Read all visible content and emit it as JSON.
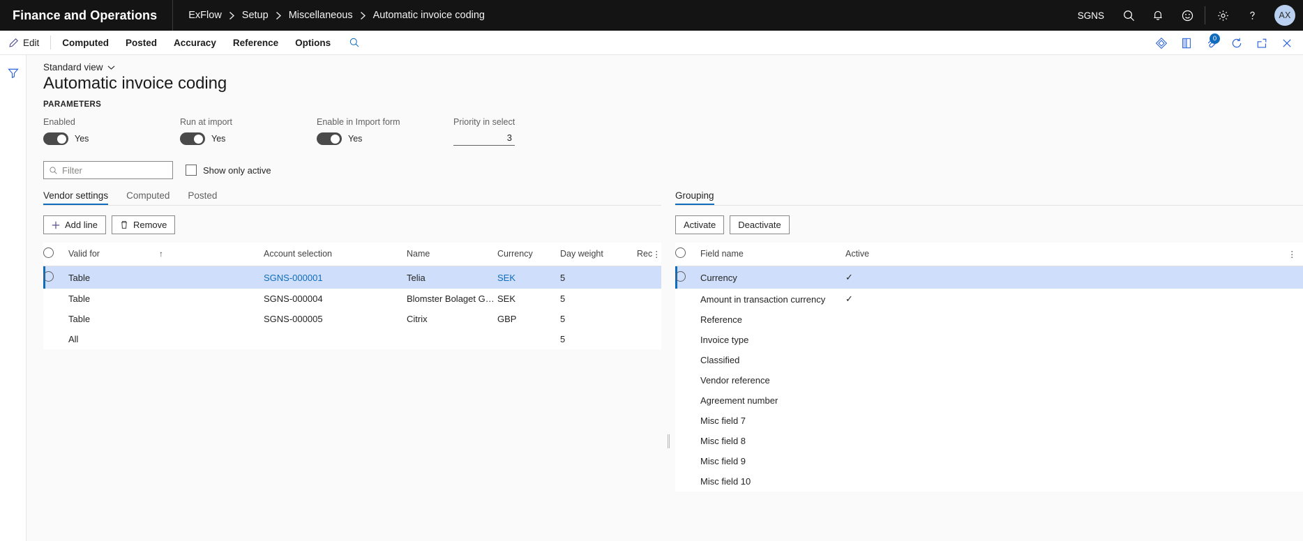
{
  "topnav": {
    "brand": "Finance and Operations",
    "breadcrumb": [
      "ExFlow",
      "Setup",
      "Miscellaneous",
      "Automatic invoice coding"
    ],
    "breadcrumb_separator": "›",
    "company": "SGNS",
    "icons": [
      "search-icon",
      "notifications-bell-icon",
      "feedback-smiley-icon",
      "settings-gear-icon",
      "help-question-icon"
    ],
    "avatar_initials": "AX",
    "accent_color": "#0f6cbd",
    "background_color": "#141414"
  },
  "actionpane": {
    "edit_label": "Edit",
    "tabs": [
      "Computed",
      "Posted",
      "Accuracy",
      "Reference",
      "Options"
    ],
    "search_icon": "search-icon",
    "right_icons": [
      "share-diamond-icon",
      "open-in-office-icon",
      "attachments-icon",
      "refresh-icon",
      "popout-icon",
      "close-icon"
    ],
    "attachment_count": "0"
  },
  "rail": {
    "filter_icon": "filter-funnel-icon"
  },
  "page": {
    "view_selector": "Standard view",
    "view_chevron": "⌄",
    "title": "Automatic invoice coding",
    "section_header": "PARAMETERS"
  },
  "parameters": [
    {
      "label": "Enabled",
      "value": "Yes",
      "on": true
    },
    {
      "label": "Run at import",
      "value": "Yes",
      "on": true
    },
    {
      "label": "Enable in Import form",
      "value": "Yes",
      "on": true
    }
  ],
  "priority": {
    "label": "Priority in select",
    "value": "3"
  },
  "filter": {
    "placeholder": "Filter",
    "value": "",
    "icon": "search-icon"
  },
  "show_only_active": {
    "label": "Show only active",
    "checked": false
  },
  "left_pane": {
    "tabs": [
      {
        "label": "Vendor settings",
        "active": true
      },
      {
        "label": "Computed",
        "active": false
      },
      {
        "label": "Posted",
        "active": false
      }
    ],
    "buttons": [
      {
        "label": "Add line",
        "icon": "plus-icon"
      },
      {
        "label": "Remove",
        "icon": "trash-icon"
      }
    ],
    "columns": [
      "Valid for",
      "Account selection",
      "Name",
      "Currency",
      "Day weight",
      "Recurrent"
    ],
    "sorted_column": "Valid for",
    "sort_direction": "↑",
    "kebab": "⋮",
    "rows": [
      {
        "valid_for": "Table",
        "account_selection": "SGNS-000001",
        "name": "Telia",
        "currency": "SEK",
        "day_weight": "5",
        "recurrent": "",
        "selected": true
      },
      {
        "valid_for": "Table",
        "account_selection": "SGNS-000004",
        "name": "Blomster Bolaget Gröna Rum",
        "currency": "SEK",
        "day_weight": "5",
        "recurrent": "",
        "selected": false
      },
      {
        "valid_for": "Table",
        "account_selection": "SGNS-000005",
        "name": "Citrix",
        "currency": "GBP",
        "day_weight": "5",
        "recurrent": "",
        "selected": false
      },
      {
        "valid_for": "All",
        "account_selection": "",
        "name": "",
        "currency": "",
        "day_weight": "5",
        "recurrent": "",
        "selected": false
      }
    ]
  },
  "right_pane": {
    "tabs": [
      {
        "label": "Grouping",
        "active": true
      }
    ],
    "buttons": [
      {
        "label": "Activate"
      },
      {
        "label": "Deactivate"
      }
    ],
    "columns": [
      "Field name",
      "Active"
    ],
    "kebab": "⋮",
    "check_glyph": "✓",
    "rows": [
      {
        "field_name": "Currency",
        "active": "✓",
        "selected": true
      },
      {
        "field_name": "Amount in transaction currency",
        "active": "✓",
        "selected": false
      },
      {
        "field_name": "Reference",
        "active": "",
        "selected": false
      },
      {
        "field_name": "Invoice type",
        "active": "",
        "selected": false
      },
      {
        "field_name": "Classified",
        "active": "",
        "selected": false
      },
      {
        "field_name": "Vendor reference",
        "active": "",
        "selected": false
      },
      {
        "field_name": "Agreement number",
        "active": "",
        "selected": false
      },
      {
        "field_name": "Misc field 7",
        "active": "",
        "selected": false
      },
      {
        "field_name": "Misc field 8",
        "active": "",
        "selected": false
      },
      {
        "field_name": "Misc field 9",
        "active": "",
        "selected": false
      },
      {
        "field_name": "Misc field 10",
        "active": "",
        "selected": false
      }
    ]
  }
}
